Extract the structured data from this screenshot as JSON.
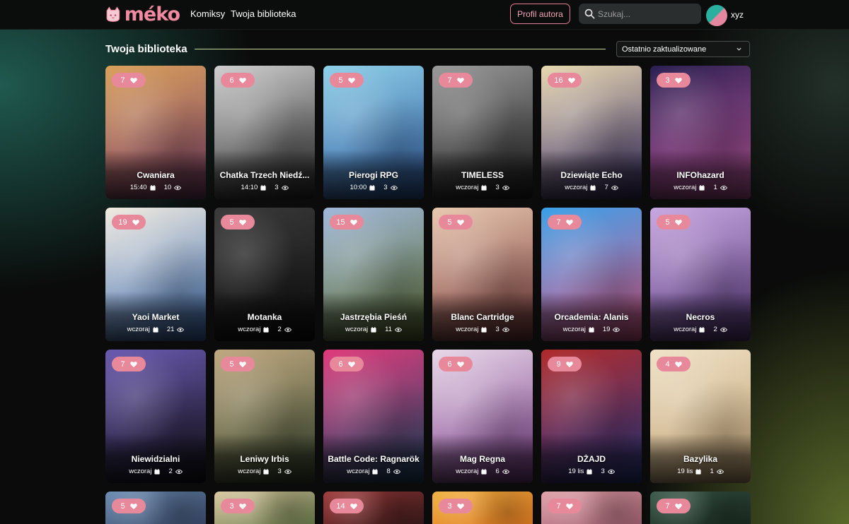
{
  "header": {
    "logo_text": "méko",
    "nav": [
      "Komiksy",
      "Twoja biblioteka"
    ],
    "author_button": "Profil autora",
    "search_placeholder": "Szukaj...",
    "username": "xyz"
  },
  "library": {
    "title": "Twoja biblioteka",
    "sort_selected": "Ostatnio zaktualizowane",
    "comics": [
      {
        "title": "Cwaniara",
        "likes": "7",
        "updated": "15:40",
        "views": "10",
        "colors": [
          "#d9a05a",
          "#7c3f6a"
        ]
      },
      {
        "title": "Chatka Trzech Niedź...",
        "likes": "6",
        "updated": "14:10",
        "views": "3",
        "colors": [
          "#cfcfcf",
          "#2a2a2a"
        ]
      },
      {
        "title": "Pierogi RPG",
        "likes": "5",
        "updated": "10:00",
        "views": "3",
        "colors": [
          "#8fd0e8",
          "#2e5aa0"
        ]
      },
      {
        "title": "TIMELESS",
        "likes": "7",
        "updated": "wczoraj",
        "views": "3",
        "colors": [
          "#9a9a9a",
          "#1e1e1e"
        ]
      },
      {
        "title": "Dziewiąte Echo",
        "likes": "16",
        "updated": "wczoraj",
        "views": "7",
        "colors": [
          "#e8d8b0",
          "#3a2f6a"
        ]
      },
      {
        "title": "INFOhazard",
        "likes": "3",
        "updated": "wczoraj",
        "views": "1",
        "colors": [
          "#2a1f50",
          "#c05aa0"
        ]
      },
      {
        "title": "Yaoi Market",
        "likes": "19",
        "updated": "wczoraj",
        "views": "21",
        "colors": [
          "#f2ece0",
          "#3a6ab0"
        ]
      },
      {
        "title": "Motanka",
        "likes": "5",
        "updated": "wczoraj",
        "views": "2",
        "colors": [
          "#3a3a3a",
          "#0f0f0f"
        ]
      },
      {
        "title": "Jastrzębia Pieśń",
        "likes": "15",
        "updated": "wczoraj",
        "views": "11",
        "colors": [
          "#a0b8d8",
          "#5a6a30"
        ]
      },
      {
        "title": "Blanc Cartridge",
        "likes": "5",
        "updated": "wczoraj",
        "views": "3",
        "colors": [
          "#e8c8b0",
          "#7a3a3a"
        ]
      },
      {
        "title": "Orcademia: Alanis",
        "likes": "7",
        "updated": "wczoraj",
        "views": "19",
        "colors": [
          "#3aa0e8",
          "#e05a8a"
        ]
      },
      {
        "title": "Necros",
        "likes": "5",
        "updated": "wczoraj",
        "views": "2",
        "colors": [
          "#c8a8e0",
          "#5a3a80"
        ]
      },
      {
        "title": "Niewidzialni",
        "likes": "7",
        "updated": "wczoraj",
        "views": "2",
        "colors": [
          "#6a5ab0",
          "#121018"
        ]
      },
      {
        "title": "Leniwy Irbis",
        "likes": "5",
        "updated": "wczoraj",
        "views": "3",
        "colors": [
          "#c0a880",
          "#3a4a30"
        ]
      },
      {
        "title": "Battle Code: Ragnarök",
        "likes": "6",
        "updated": "wczoraj",
        "views": "8",
        "colors": [
          "#e03a7a",
          "#1a4a6a"
        ]
      },
      {
        "title": "Mag Regna",
        "likes": "6",
        "updated": "wczoraj",
        "views": "6",
        "colors": [
          "#e8d8e8",
          "#7a3a8a"
        ]
      },
      {
        "title": "DŻAJD",
        "likes": "9",
        "updated": "19 lis",
        "views": "3",
        "colors": [
          "#b02a2a",
          "#2a3a8a"
        ]
      },
      {
        "title": "Bazylika",
        "likes": "4",
        "updated": "19 lis",
        "views": "1",
        "colors": [
          "#f0e2c8",
          "#c0a070"
        ]
      },
      {
        "title": "",
        "likes": "5",
        "updated": "",
        "views": "",
        "colors": [
          "#6a8ab0",
          "#3a4a6a"
        ]
      },
      {
        "title": "",
        "likes": "3",
        "updated": "",
        "views": "",
        "colors": [
          "#d8c8a0",
          "#6a7a4a"
        ]
      },
      {
        "title": "",
        "likes": "14",
        "updated": "",
        "views": "",
        "colors": [
          "#a03a3a",
          "#3a1a1a"
        ]
      },
      {
        "title": "",
        "likes": "3",
        "updated": "",
        "views": "",
        "colors": [
          "#f0b040",
          "#e07a20"
        ]
      },
      {
        "title": "",
        "likes": "7",
        "updated": "",
        "views": "",
        "colors": [
          "#e0a0a8",
          "#a06070"
        ]
      },
      {
        "title": "",
        "likes": "7",
        "updated": "",
        "views": "",
        "colors": [
          "#3a5a4a",
          "#1a2a20"
        ]
      }
    ]
  },
  "icons": {
    "heart": "heart-icon",
    "calendar": "calendar-icon",
    "eye": "eye-icon",
    "search": "search-icon",
    "chevron": "chevron-down-icon"
  },
  "colors": {
    "accent_pink": "#e8899b",
    "logo_pink": "#f08aa0",
    "divider": "#c7d89a"
  }
}
